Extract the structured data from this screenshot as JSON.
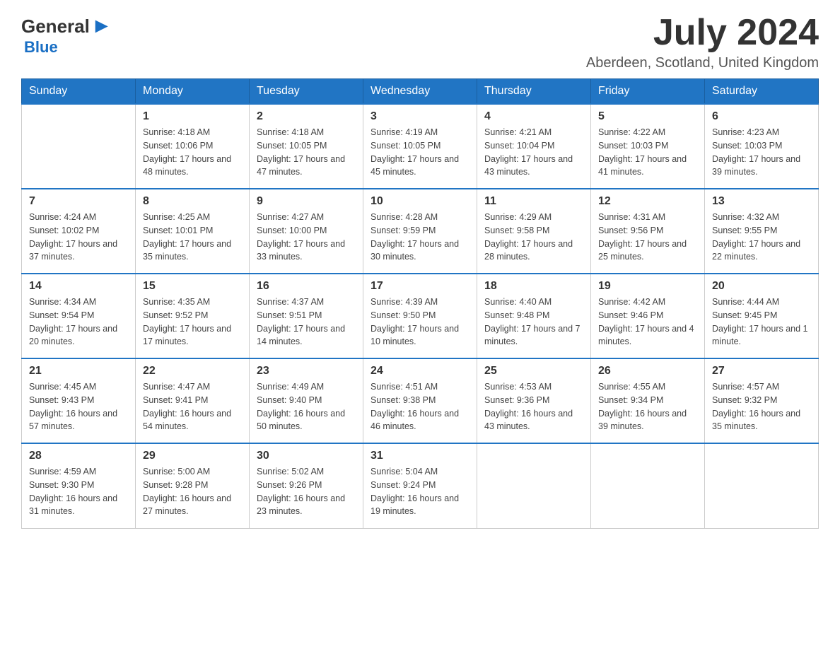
{
  "logo": {
    "general": "General",
    "blue": "Blue"
  },
  "header": {
    "month_year": "July 2024",
    "location": "Aberdeen, Scotland, United Kingdom"
  },
  "days_of_week": [
    "Sunday",
    "Monday",
    "Tuesday",
    "Wednesday",
    "Thursday",
    "Friday",
    "Saturday"
  ],
  "weeks": [
    [
      {
        "day": "",
        "sunrise": "",
        "sunset": "",
        "daylight": ""
      },
      {
        "day": "1",
        "sunrise": "Sunrise: 4:18 AM",
        "sunset": "Sunset: 10:06 PM",
        "daylight": "Daylight: 17 hours and 48 minutes."
      },
      {
        "day": "2",
        "sunrise": "Sunrise: 4:18 AM",
        "sunset": "Sunset: 10:05 PM",
        "daylight": "Daylight: 17 hours and 47 minutes."
      },
      {
        "day": "3",
        "sunrise": "Sunrise: 4:19 AM",
        "sunset": "Sunset: 10:05 PM",
        "daylight": "Daylight: 17 hours and 45 minutes."
      },
      {
        "day": "4",
        "sunrise": "Sunrise: 4:21 AM",
        "sunset": "Sunset: 10:04 PM",
        "daylight": "Daylight: 17 hours and 43 minutes."
      },
      {
        "day": "5",
        "sunrise": "Sunrise: 4:22 AM",
        "sunset": "Sunset: 10:03 PM",
        "daylight": "Daylight: 17 hours and 41 minutes."
      },
      {
        "day": "6",
        "sunrise": "Sunrise: 4:23 AM",
        "sunset": "Sunset: 10:03 PM",
        "daylight": "Daylight: 17 hours and 39 minutes."
      }
    ],
    [
      {
        "day": "7",
        "sunrise": "Sunrise: 4:24 AM",
        "sunset": "Sunset: 10:02 PM",
        "daylight": "Daylight: 17 hours and 37 minutes."
      },
      {
        "day": "8",
        "sunrise": "Sunrise: 4:25 AM",
        "sunset": "Sunset: 10:01 PM",
        "daylight": "Daylight: 17 hours and 35 minutes."
      },
      {
        "day": "9",
        "sunrise": "Sunrise: 4:27 AM",
        "sunset": "Sunset: 10:00 PM",
        "daylight": "Daylight: 17 hours and 33 minutes."
      },
      {
        "day": "10",
        "sunrise": "Sunrise: 4:28 AM",
        "sunset": "Sunset: 9:59 PM",
        "daylight": "Daylight: 17 hours and 30 minutes."
      },
      {
        "day": "11",
        "sunrise": "Sunrise: 4:29 AM",
        "sunset": "Sunset: 9:58 PM",
        "daylight": "Daylight: 17 hours and 28 minutes."
      },
      {
        "day": "12",
        "sunrise": "Sunrise: 4:31 AM",
        "sunset": "Sunset: 9:56 PM",
        "daylight": "Daylight: 17 hours and 25 minutes."
      },
      {
        "day": "13",
        "sunrise": "Sunrise: 4:32 AM",
        "sunset": "Sunset: 9:55 PM",
        "daylight": "Daylight: 17 hours and 22 minutes."
      }
    ],
    [
      {
        "day": "14",
        "sunrise": "Sunrise: 4:34 AM",
        "sunset": "Sunset: 9:54 PM",
        "daylight": "Daylight: 17 hours and 20 minutes."
      },
      {
        "day": "15",
        "sunrise": "Sunrise: 4:35 AM",
        "sunset": "Sunset: 9:52 PM",
        "daylight": "Daylight: 17 hours and 17 minutes."
      },
      {
        "day": "16",
        "sunrise": "Sunrise: 4:37 AM",
        "sunset": "Sunset: 9:51 PM",
        "daylight": "Daylight: 17 hours and 14 minutes."
      },
      {
        "day": "17",
        "sunrise": "Sunrise: 4:39 AM",
        "sunset": "Sunset: 9:50 PM",
        "daylight": "Daylight: 17 hours and 10 minutes."
      },
      {
        "day": "18",
        "sunrise": "Sunrise: 4:40 AM",
        "sunset": "Sunset: 9:48 PM",
        "daylight": "Daylight: 17 hours and 7 minutes."
      },
      {
        "day": "19",
        "sunrise": "Sunrise: 4:42 AM",
        "sunset": "Sunset: 9:46 PM",
        "daylight": "Daylight: 17 hours and 4 minutes."
      },
      {
        "day": "20",
        "sunrise": "Sunrise: 4:44 AM",
        "sunset": "Sunset: 9:45 PM",
        "daylight": "Daylight: 17 hours and 1 minute."
      }
    ],
    [
      {
        "day": "21",
        "sunrise": "Sunrise: 4:45 AM",
        "sunset": "Sunset: 9:43 PM",
        "daylight": "Daylight: 16 hours and 57 minutes."
      },
      {
        "day": "22",
        "sunrise": "Sunrise: 4:47 AM",
        "sunset": "Sunset: 9:41 PM",
        "daylight": "Daylight: 16 hours and 54 minutes."
      },
      {
        "day": "23",
        "sunrise": "Sunrise: 4:49 AM",
        "sunset": "Sunset: 9:40 PM",
        "daylight": "Daylight: 16 hours and 50 minutes."
      },
      {
        "day": "24",
        "sunrise": "Sunrise: 4:51 AM",
        "sunset": "Sunset: 9:38 PM",
        "daylight": "Daylight: 16 hours and 46 minutes."
      },
      {
        "day": "25",
        "sunrise": "Sunrise: 4:53 AM",
        "sunset": "Sunset: 9:36 PM",
        "daylight": "Daylight: 16 hours and 43 minutes."
      },
      {
        "day": "26",
        "sunrise": "Sunrise: 4:55 AM",
        "sunset": "Sunset: 9:34 PM",
        "daylight": "Daylight: 16 hours and 39 minutes."
      },
      {
        "day": "27",
        "sunrise": "Sunrise: 4:57 AM",
        "sunset": "Sunset: 9:32 PM",
        "daylight": "Daylight: 16 hours and 35 minutes."
      }
    ],
    [
      {
        "day": "28",
        "sunrise": "Sunrise: 4:59 AM",
        "sunset": "Sunset: 9:30 PM",
        "daylight": "Daylight: 16 hours and 31 minutes."
      },
      {
        "day": "29",
        "sunrise": "Sunrise: 5:00 AM",
        "sunset": "Sunset: 9:28 PM",
        "daylight": "Daylight: 16 hours and 27 minutes."
      },
      {
        "day": "30",
        "sunrise": "Sunrise: 5:02 AM",
        "sunset": "Sunset: 9:26 PM",
        "daylight": "Daylight: 16 hours and 23 minutes."
      },
      {
        "day": "31",
        "sunrise": "Sunrise: 5:04 AM",
        "sunset": "Sunset: 9:24 PM",
        "daylight": "Daylight: 16 hours and 19 minutes."
      },
      {
        "day": "",
        "sunrise": "",
        "sunset": "",
        "daylight": ""
      },
      {
        "day": "",
        "sunrise": "",
        "sunset": "",
        "daylight": ""
      },
      {
        "day": "",
        "sunrise": "",
        "sunset": "",
        "daylight": ""
      }
    ]
  ]
}
